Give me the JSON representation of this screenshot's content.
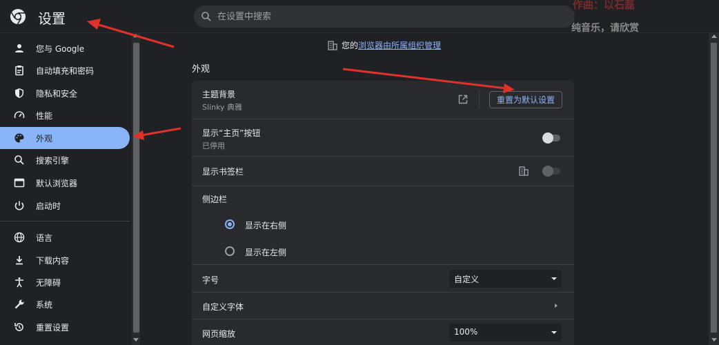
{
  "header": {
    "title": "设置",
    "search_placeholder": "在设置中搜索",
    "watermark_line1": "作曲：以石磊",
    "watermark_line2": "纯音乐，请欣赏"
  },
  "sidebar": {
    "items": [
      {
        "label": "您与 Google",
        "icon": "person-icon"
      },
      {
        "label": "自动填充和密码",
        "icon": "clipboard-icon"
      },
      {
        "label": "隐私和安全",
        "icon": "shield-icon"
      },
      {
        "label": "性能",
        "icon": "speedometer-icon"
      },
      {
        "label": "外观",
        "icon": "palette-icon",
        "active": true
      },
      {
        "label": "搜索引擎",
        "icon": "search-icon"
      },
      {
        "label": "默认浏览器",
        "icon": "browser-icon"
      },
      {
        "label": "启动时",
        "icon": "power-icon"
      },
      {
        "label": "语言",
        "icon": "globe-icon"
      },
      {
        "label": "下载内容",
        "icon": "download-icon"
      },
      {
        "label": "无障碍",
        "icon": "accessibility-icon"
      },
      {
        "label": "系统",
        "icon": "wrench-icon"
      },
      {
        "label": "重置设置",
        "icon": "reset-icon"
      }
    ]
  },
  "main": {
    "managed_prefix": "您的",
    "managed_link": "浏览器由所属组织管理",
    "section_title": "外观",
    "theme": {
      "label": "主题背景",
      "value": "Slinky 典雅",
      "reset_button": "重置为默认设置"
    },
    "home_button": {
      "label": "显示“主页”按钮",
      "status": "已停用"
    },
    "bookmarks_bar": {
      "label": "显示书签栏"
    },
    "side_panel": {
      "label": "侧边栏",
      "options": [
        {
          "label": "显示在右侧",
          "selected": true
        },
        {
          "label": "显示在左侧",
          "selected": false
        }
      ]
    },
    "font_size": {
      "label": "字号",
      "value": "自定义"
    },
    "custom_fonts": {
      "label": "自定义字体"
    },
    "page_zoom": {
      "label": "网页缩放",
      "value": "100%"
    }
  },
  "colors": {
    "accent": "#8ab4f8",
    "background": "#202124",
    "card": "#292a2d",
    "annotation": "#e0322b"
  }
}
